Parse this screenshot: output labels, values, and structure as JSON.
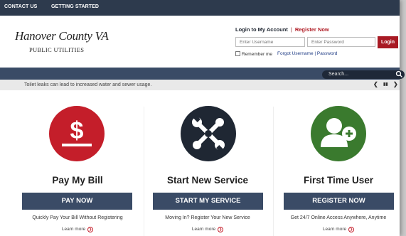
{
  "topbar": {
    "contact": "CONTACT US",
    "started": "GETTING STARTED"
  },
  "logo": {
    "line1": "Hanover County VA",
    "line2": "PUBLIC UTILITIES"
  },
  "login": {
    "heading": "Login to My Account",
    "separator": "|",
    "register": "Register Now",
    "username_placeholder": "Enter Username",
    "password_placeholder": "Enter Password",
    "button": "Login",
    "remember": "Remember me",
    "forgot": "Forgot Username | Password"
  },
  "search": {
    "placeholder": "Search..."
  },
  "ticker": {
    "message": "Toilet leaks can lead to increased water and sewer usage."
  },
  "cards": [
    {
      "title": "Pay My Bill",
      "button": "PAY NOW",
      "text": "Quickly Pay Your Bill Without Registering",
      "link": "Learn more",
      "icon": "dollar-icon",
      "color": "#c41e2a"
    },
    {
      "title": "Start New Service",
      "button": "START MY SERVICE",
      "text": "Moving In? Register Your New Service",
      "link": "Learn more",
      "icon": "tools-icon",
      "color": "#1f2733"
    },
    {
      "title": "First Time User",
      "button": "REGISTER NOW",
      "text": "Get 24/7 Online Access Anywhere, Anytime",
      "link": "Learn more",
      "icon": "add-user-icon",
      "color": "#3a7a2e"
    }
  ],
  "colors": {
    "nav": "#3a4b66",
    "topbar": "#2d3a4d",
    "accent": "#a81a24"
  }
}
